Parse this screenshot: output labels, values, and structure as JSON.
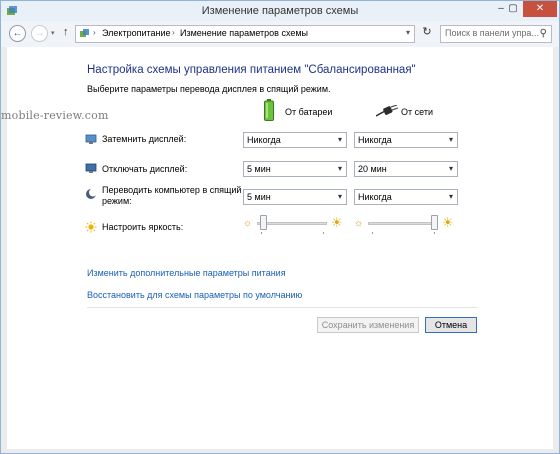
{
  "window": {
    "title": "Изменение параметров схемы",
    "minimize": "–",
    "maximize": "▢",
    "close": "✕"
  },
  "nav": {
    "back": "←",
    "forward": "→",
    "recent": "▾",
    "up": "↑",
    "breadcrumb_sep": "›",
    "breadcrumb": [
      "Электропитание",
      "Изменение параметров схемы"
    ],
    "address_dropdown": "▾",
    "refresh": "↻",
    "search_placeholder": "Поиск в панели упра...",
    "search_glyph": "⚲"
  },
  "main": {
    "heading": "Настройка схемы управления питанием \"Сбалансированная\"",
    "subtitle": "Выберите параметры перевода дисплея в спящий режим.",
    "col_battery": "От батареи",
    "col_ac": "От сети",
    "rows": [
      {
        "label": "Затемнить дисплей:",
        "battery": "Никогда",
        "ac": "Никогда"
      },
      {
        "label": "Отключать дисплей:",
        "battery": "5 мин",
        "ac": "20 мин"
      },
      {
        "label": "Переводить компьютер в спящий режим:",
        "battery": "5 мин",
        "ac": "Никогда"
      }
    ],
    "brightness_label": "Настроить яркость:",
    "brightness": {
      "battery": 0.05,
      "ac": 1.0
    },
    "dim_glyph": "☼",
    "bright_glyph": "☀",
    "dropdown_arrow": "▾",
    "link_advanced": "Изменить дополнительные параметры питания",
    "link_restore": "Восстановить для схемы параметры по умолчанию",
    "save_button": "Сохранить изменения",
    "cancel_button": "Отмена"
  },
  "watermark": "mobile-review.com",
  "colors": {
    "heading": "#1e3287",
    "link": "#1a5fb4",
    "close_button": "#c7513f",
    "titlebar": "#e9f0f8"
  }
}
